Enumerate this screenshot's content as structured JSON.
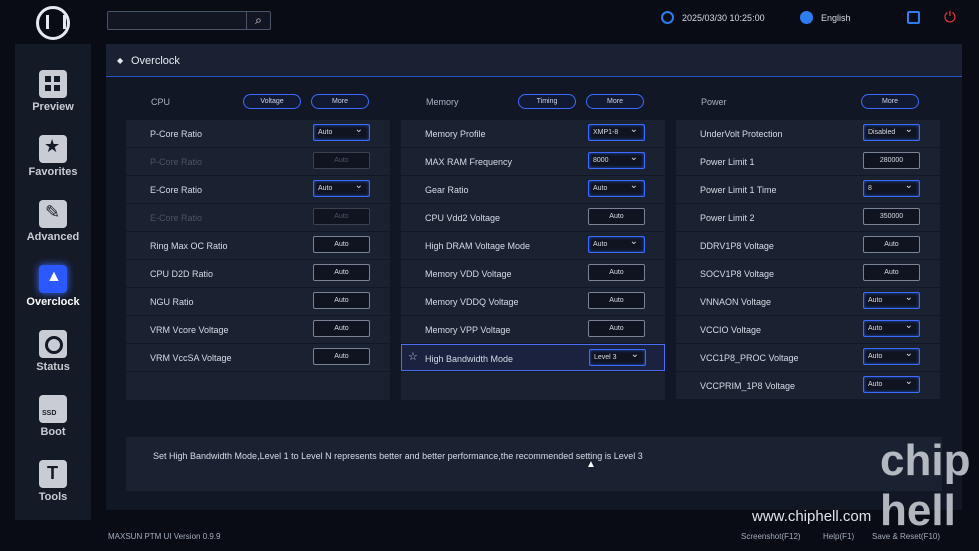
{
  "topbar": {
    "search_placeholder": "",
    "datetime": "2025/03/30 10:25:00",
    "language": "English"
  },
  "sidebar": {
    "items": [
      {
        "label": "Preview",
        "icon": "preview-icon"
      },
      {
        "label": "Favorites",
        "icon": "star-icon"
      },
      {
        "label": "Advanced",
        "icon": "wrench-icon"
      },
      {
        "label": "Overclock",
        "icon": "rocket-icon",
        "active": true
      },
      {
        "label": "Status",
        "icon": "status-icon"
      },
      {
        "label": "Boot",
        "icon": "ssd-icon"
      },
      {
        "label": "Tools",
        "icon": "tools-icon"
      }
    ]
  },
  "page": {
    "title": "Overclock"
  },
  "columns": [
    {
      "title": "CPU",
      "buttons": [
        "Voltage",
        "More"
      ],
      "rows": [
        {
          "name": "P-Core Ratio",
          "value": "Auto",
          "type": "dropdown"
        },
        {
          "name": "P-Core Ratio",
          "value": "Auto",
          "type": "disabled"
        },
        {
          "name": "E-Core Ratio",
          "value": "Auto",
          "type": "dropdown"
        },
        {
          "name": "E-Core Ratio",
          "value": "Auto",
          "type": "disabled"
        },
        {
          "name": "Ring Max OC Ratio",
          "value": "Auto",
          "type": "input"
        },
        {
          "name": "CPU D2D Ratio",
          "value": "Auto",
          "type": "input"
        },
        {
          "name": "NGU Ratio",
          "value": "Auto",
          "type": "input"
        },
        {
          "name": "VRM Vcore Voltage",
          "value": "Auto",
          "type": "input"
        },
        {
          "name": "VRM VccSA Voltage",
          "value": "Auto",
          "type": "input"
        }
      ]
    },
    {
      "title": "Memory",
      "buttons": [
        "Timing",
        "More"
      ],
      "rows": [
        {
          "name": "Memory Profile",
          "value": "XMP1-8",
          "type": "dropdown"
        },
        {
          "name": "MAX RAM Frequency",
          "value": "8000",
          "type": "dropdown"
        },
        {
          "name": "Gear Ratio",
          "value": "Auto",
          "type": "dropdown"
        },
        {
          "name": "CPU Vdd2 Voltage",
          "value": "Auto",
          "type": "input"
        },
        {
          "name": "High DRAM Voltage Mode",
          "value": "Auto",
          "type": "dropdown"
        },
        {
          "name": "Memory VDD Voltage",
          "value": "Auto",
          "type": "input"
        },
        {
          "name": "Memory VDDQ Voltage",
          "value": "Auto",
          "type": "input"
        },
        {
          "name": "Memory VPP Voltage",
          "value": "Auto",
          "type": "input"
        },
        {
          "name": "High Bandwidth Mode",
          "value": "Level 3",
          "type": "dropdown",
          "selected": true
        }
      ]
    },
    {
      "title": "Power",
      "buttons": [
        "More"
      ],
      "rows": [
        {
          "name": "UnderVolt Protection",
          "value": "Disabled",
          "type": "dropdown"
        },
        {
          "name": "Power Limit 1",
          "value": "280000",
          "type": "input"
        },
        {
          "name": "Power Limit 1 Time",
          "value": "8",
          "type": "dropdown"
        },
        {
          "name": "Power Limit 2",
          "value": "350000",
          "type": "input"
        },
        {
          "name": "DDRV1P8 Voltage",
          "value": "Auto",
          "type": "input"
        },
        {
          "name": "SOCV1P8 Voltage",
          "value": "Auto",
          "type": "input"
        },
        {
          "name": "VNNAON Voltage",
          "value": "Auto",
          "type": "dropdown"
        },
        {
          "name": "VCCIO Voltage",
          "value": "Auto",
          "type": "dropdown"
        },
        {
          "name": "VCC1P8_PROC Voltage",
          "value": "Auto",
          "type": "dropdown"
        },
        {
          "name": "VCCPRIM_1P8 Voltage",
          "value": "Auto",
          "type": "dropdown"
        }
      ]
    }
  ],
  "description": "Set High Bandwidth Mode,Level 1 to Level N represents better and better performance,the recommended setting is Level 3",
  "footer": {
    "version": "MAXSUN PTM UI Version 0.9.9",
    "screenshot": "Screenshot(F12)",
    "help": "Help(F1)",
    "save_reset": "Save & Reset(F10)"
  },
  "watermark": {
    "url": "www.chiphell.com",
    "logo_text": "chip hell"
  },
  "colors": {
    "accent": "#3c6cff",
    "power": "#f0393a",
    "background": "#090c14"
  }
}
